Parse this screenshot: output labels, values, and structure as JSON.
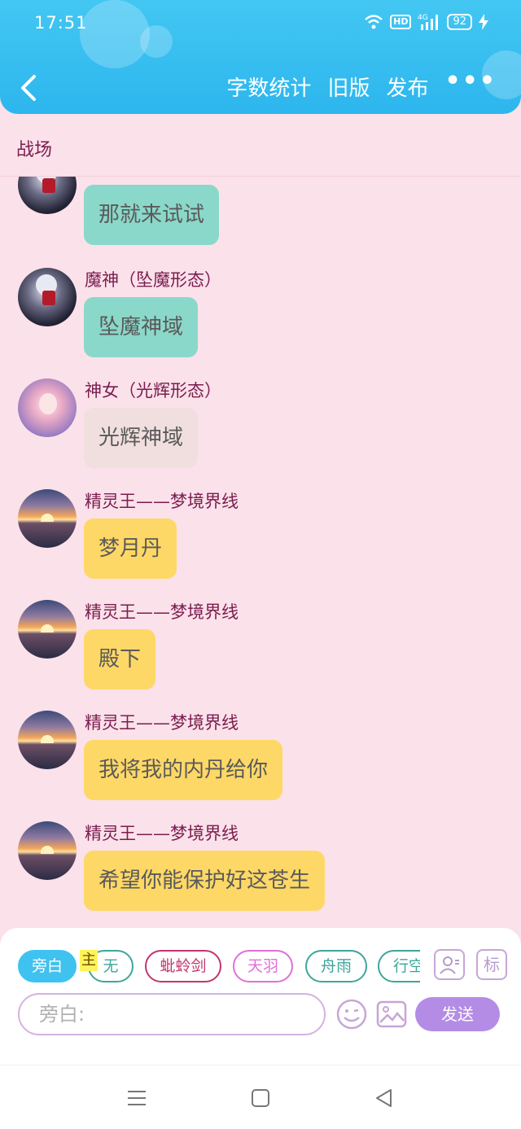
{
  "status_bar": {
    "time": "17:51",
    "network": "4G",
    "hd": "HD",
    "battery": "92"
  },
  "header": {
    "word_count": "字数统计",
    "old_version": "旧版",
    "publish": "发布",
    "more": "•••"
  },
  "chat": {
    "title": "战场"
  },
  "messages": [
    {
      "sender": "",
      "text": "那就来试试",
      "bubble": "teal",
      "avatar": "dark-character-avatar"
    },
    {
      "sender": "魔神（坠魔形态）",
      "text": "坠魔神域",
      "bubble": "teal",
      "avatar": "dark-character-avatar"
    },
    {
      "sender": "神女（光辉形态）",
      "text": "光辉神域",
      "bubble": "grey",
      "avatar": "pink-character-avatar"
    },
    {
      "sender": "精灵王——梦境界线",
      "text": "梦月丹",
      "bubble": "yellow",
      "avatar": "sunset-avatar"
    },
    {
      "sender": "精灵王——梦境界线",
      "text": "殿下",
      "bubble": "yellow",
      "avatar": "sunset-avatar"
    },
    {
      "sender": "精灵王——梦境界线",
      "text": "我将我的内丹给你",
      "bubble": "yellow",
      "avatar": "sunset-avatar"
    },
    {
      "sender": "精灵王——梦境界线",
      "text": "希望你能保护好这苍生",
      "bubble": "yellow",
      "avatar": "sunset-avatar"
    }
  ],
  "roles": [
    {
      "label": "旁白",
      "color": "#3fc2f0",
      "active": true
    },
    {
      "label": "无",
      "color": "#3ea69b",
      "active": false
    },
    {
      "label": "蚍蛉剑",
      "color": "#c4346e",
      "active": false
    },
    {
      "label": "天羽",
      "color": "#e070d6",
      "active": false
    },
    {
      "label": "舟雨",
      "color": "#3ea69b",
      "active": false
    },
    {
      "label": "行空",
      "color": "#3ea69b",
      "active": false
    }
  ],
  "host_tag": "主",
  "tag_button": "标",
  "input": {
    "placeholder": "旁白:"
  },
  "send_button": "发送"
}
